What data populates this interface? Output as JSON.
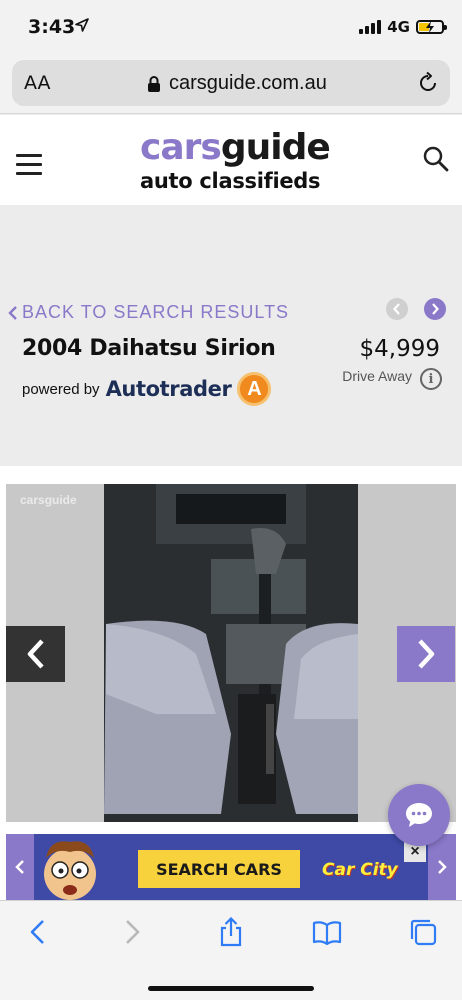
{
  "status_bar": {
    "time": "3:43",
    "network": "4G"
  },
  "browser": {
    "text_size_label": "AA",
    "url": "carsguide.com.au"
  },
  "site": {
    "logo_part1": "cars",
    "logo_part2": "guide",
    "logo_subtitle": "auto classifieds",
    "brand_color": "#8a78c9"
  },
  "listing": {
    "back_label": "BACK TO SEARCH RESULTS",
    "title": "2004 Daihatsu Sirion",
    "price": "$4,999",
    "price_note": "Drive Away",
    "powered_by": "powered by",
    "partner": "Autotrader",
    "partner_logo_letter": "A"
  },
  "gallery": {
    "watermark": "carsguide"
  },
  "ad": {
    "cta": "SEARCH CARS",
    "brand": "Car City",
    "close": "×"
  },
  "icons": [
    "location-arrow-icon",
    "signal-icon",
    "battery-icon",
    "lock-icon",
    "reload-icon",
    "hamburger-icon",
    "search-icon",
    "chevron-left-icon",
    "chevron-right-icon",
    "info-icon",
    "chat-icon",
    "back-icon",
    "forward-icon",
    "share-icon",
    "bookmarks-icon",
    "tabs-icon"
  ]
}
